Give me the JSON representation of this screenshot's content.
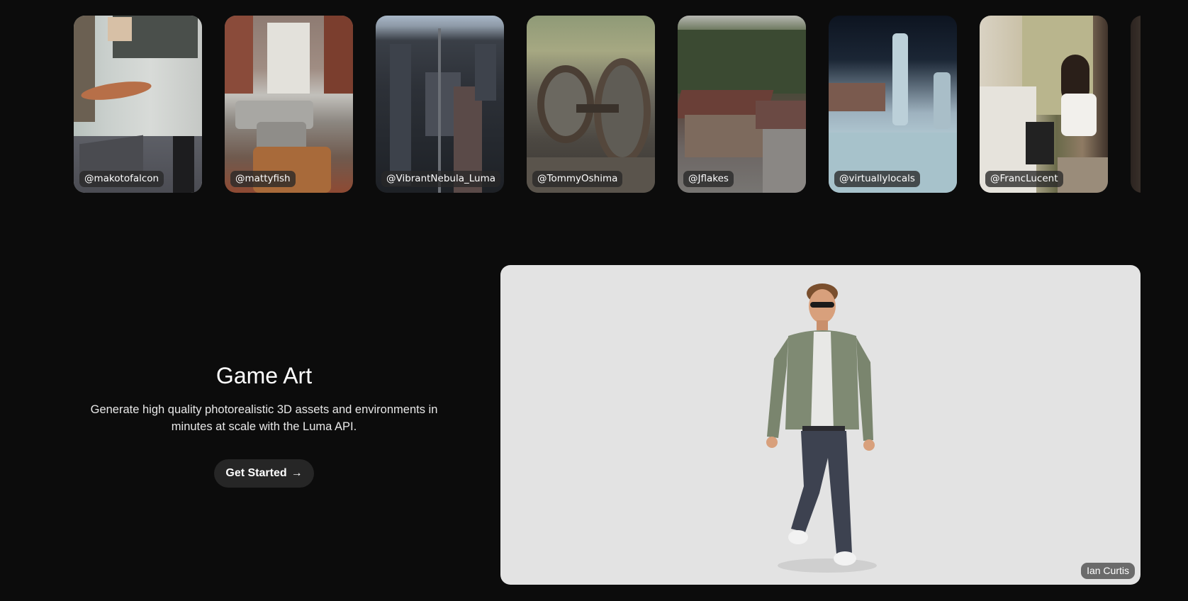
{
  "gallery": {
    "cards": [
      {
        "label": "@makotofalcon",
        "scene": "museum-submarine-image"
      },
      {
        "label": "@mattyfish",
        "scene": "living-room-image"
      },
      {
        "label": "@VibrantNebula_Luma",
        "scene": "aerial-city-image"
      },
      {
        "label": "@TommyOshima",
        "scene": "train-wheels-image"
      },
      {
        "label": "@Jflakes",
        "scene": "mountain-lodge-image"
      },
      {
        "label": "@virtuallylocals",
        "scene": "ice-sculpture-image"
      },
      {
        "label": "@FrancLucent",
        "scene": "piano-player-image"
      },
      {
        "label": "",
        "scene": "partial-card-image"
      }
    ]
  },
  "section": {
    "title": "Game Art",
    "description": "Generate high quality photorealistic 3D assets and environments in minutes at scale with the Luma API.",
    "cta_label": "Get Started",
    "cta_icon": "arrow-right-icon"
  },
  "showcase": {
    "credit": "Ian Curtis",
    "subject": "3d-person-model-image"
  },
  "colors": {
    "background": "#0c0c0c",
    "showcase_bg": "#e3e3e3",
    "button_bg": "#262626",
    "label_bg": "#282828"
  }
}
